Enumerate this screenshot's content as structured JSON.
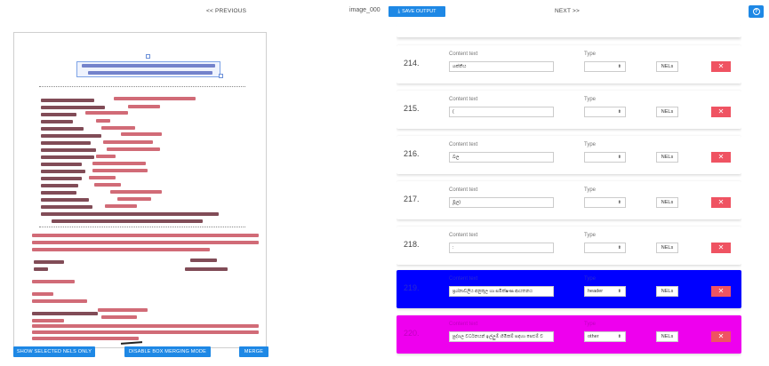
{
  "topbar": {
    "previous_label": "<< PREVIOUS",
    "image_name": "image_000",
    "save_label": "SAVE OUTPUT",
    "next_label": "NEXT >>",
    "help_glyph": "?"
  },
  "left_panel": {
    "buttons": {
      "show_selected": "SHOW SELECTED NELS ONLY",
      "disable_merging": "DISABLE BOX MERGING MODE",
      "merge": "MERGE"
    }
  },
  "entries": {
    "content_label": "Content text",
    "type_label": "Type",
    "nels_label": "NELs",
    "delete_glyph": "✕",
    "items": [
      {
        "num": "214.",
        "content": "ශක්තිය",
        "type": ""
      },
      {
        "num": "215.",
        "content": "(",
        "type": ""
      },
      {
        "num": "216.",
        "content": "බල",
        "type": ""
      },
      {
        "num": "217.",
        "content": "මූල)",
        "type": ""
      },
      {
        "num": "218.",
        "content": ":",
        "type": ""
      },
      {
        "num": "219.",
        "content": "ප්‍රශ්නාවලිය අනුකූල හා සමීක්ෂණ ආයතනය",
        "type": "header"
      },
      {
        "num": "220.",
        "content": "පුද්ගල වර්ධනයන් ඉල්ලුම් හිමිකම් සඳහා පෙළුම් ව",
        "type": "other"
      }
    ]
  },
  "colors": {
    "accent": "#1e88e5",
    "delete": "#ef5362",
    "header_highlight": "#0000ff",
    "other_highlight": "#ee00ee"
  }
}
